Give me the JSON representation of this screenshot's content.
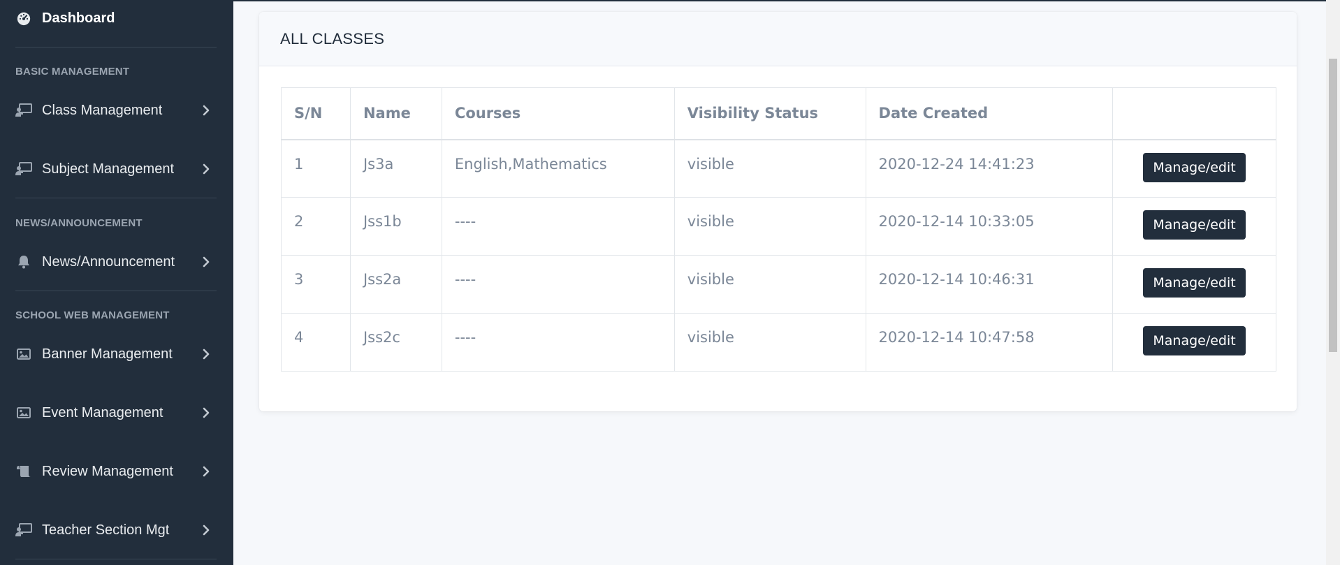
{
  "sidebar": {
    "dashboard_label": "Dashboard",
    "sections": [
      {
        "header": "BASIC MANAGEMENT",
        "items": [
          "Class Management",
          "Subject Management"
        ]
      },
      {
        "header": "NEWS/ANNOUNCEMENT",
        "items": [
          "News/Announcement"
        ]
      },
      {
        "header": "SCHOOL WEB MANAGEMENT",
        "items": [
          "Banner Management",
          "Event Management",
          "Review Management",
          "Teacher Section Mgt"
        ]
      }
    ]
  },
  "card": {
    "title": "ALL CLASSES",
    "table": {
      "headers": [
        "S/N",
        "Name",
        "Courses",
        "Visibility Status",
        "Date Created",
        ""
      ],
      "rows": [
        {
          "sn": "1",
          "name": "Js3a",
          "courses": "English,Mathematics",
          "visibility": "visible",
          "date": "2020-12-24 14:41:23",
          "action": "Manage/edit"
        },
        {
          "sn": "2",
          "name": "Jss1b",
          "courses": "----",
          "visibility": "visible",
          "date": "2020-12-14 10:33:05",
          "action": "Manage/edit"
        },
        {
          "sn": "3",
          "name": "Jss2a",
          "courses": "----",
          "visibility": "visible",
          "date": "2020-12-14 10:46:31",
          "action": "Manage/edit"
        },
        {
          "sn": "4",
          "name": "Jss2c",
          "courses": "----",
          "visibility": "visible",
          "date": "2020-12-14 10:47:58",
          "action": "Manage/edit"
        }
      ]
    }
  },
  "colors": {
    "sidebar_bg": "#222e3c",
    "button_bg": "#222e3c",
    "page_bg": "#f6f8fb"
  }
}
